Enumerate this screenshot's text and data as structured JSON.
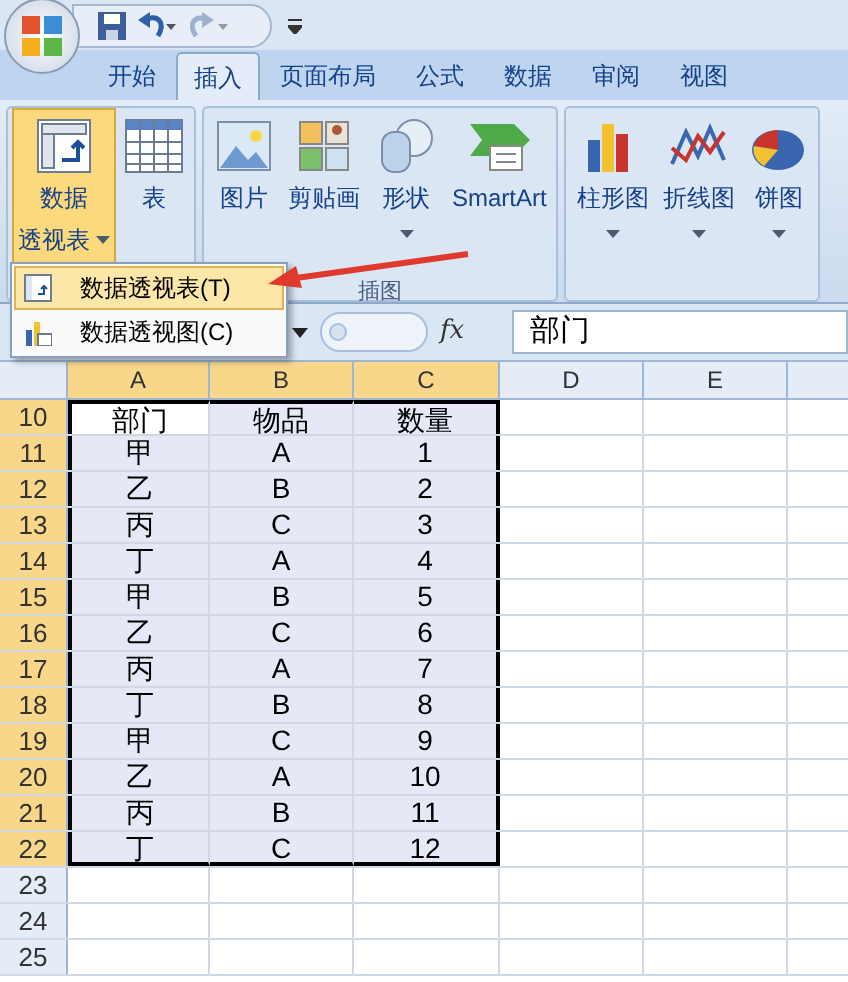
{
  "tabs": [
    {
      "label": "开始",
      "selected": false
    },
    {
      "label": "插入",
      "selected": true
    },
    {
      "label": "页面布局",
      "selected": false
    },
    {
      "label": "公式",
      "selected": false
    },
    {
      "label": "数据",
      "selected": false
    },
    {
      "label": "审阅",
      "selected": false
    },
    {
      "label": "视图",
      "selected": false
    }
  ],
  "ribbon": {
    "groups": [
      {
        "buttons": [
          {
            "kind": "pivot",
            "lines": [
              "数据",
              "透视表"
            ],
            "dropdown": true,
            "selected": true
          },
          {
            "kind": "table",
            "lines": [
              "表"
            ],
            "dropdown": false,
            "selected": false
          }
        ]
      },
      {
        "label": "插图",
        "buttons": [
          {
            "kind": "picture",
            "lines": [
              "图片"
            ],
            "dropdown": false,
            "selected": false
          },
          {
            "kind": "clipart",
            "lines": [
              "剪贴画"
            ],
            "dropdown": false,
            "selected": false
          },
          {
            "kind": "shapes",
            "lines": [
              "形状"
            ],
            "dropdown": true,
            "selected": false
          },
          {
            "kind": "smartart",
            "lines": [
              "SmartArt"
            ],
            "dropdown": false,
            "selected": false
          }
        ]
      },
      {
        "buttons": [
          {
            "kind": "column",
            "lines": [
              "柱形图"
            ],
            "dropdown": true,
            "selected": false
          },
          {
            "kind": "line",
            "lines": [
              "折线图"
            ],
            "dropdown": true,
            "selected": false
          },
          {
            "kind": "pie",
            "lines": [
              "饼图"
            ],
            "dropdown": true,
            "selected": false
          }
        ]
      }
    ]
  },
  "menu": {
    "items": [
      {
        "kind": "pivot",
        "label": "数据透视表(T)",
        "selected": true
      },
      {
        "kind": "chart",
        "label": "数据透视图(C)",
        "selected": false
      }
    ]
  },
  "formula_bar": {
    "function_label": "fx",
    "content": "部门"
  },
  "columns": [
    {
      "label": "A",
      "selected": true
    },
    {
      "label": "B",
      "selected": true
    },
    {
      "label": "C",
      "selected": true
    },
    {
      "label": "D",
      "selected": false
    },
    {
      "label": "E",
      "selected": false
    }
  ],
  "rows": [
    {
      "number": "10",
      "selected": true,
      "cells": [
        "部门",
        "物品",
        "数量"
      ]
    },
    {
      "number": "11",
      "selected": true,
      "cells": [
        "甲",
        "A",
        "1"
      ]
    },
    {
      "number": "12",
      "selected": true,
      "cells": [
        "乙",
        "B",
        "2"
      ]
    },
    {
      "number": "13",
      "selected": true,
      "cells": [
        "丙",
        "C",
        "3"
      ]
    },
    {
      "number": "14",
      "selected": true,
      "cells": [
        "丁",
        "A",
        "4"
      ]
    },
    {
      "number": "15",
      "selected": true,
      "cells": [
        "甲",
        "B",
        "5"
      ]
    },
    {
      "number": "16",
      "selected": true,
      "cells": [
        "乙",
        "C",
        "6"
      ]
    },
    {
      "number": "17",
      "selected": true,
      "cells": [
        "丙",
        "A",
        "7"
      ]
    },
    {
      "number": "18",
      "selected": true,
      "cells": [
        "丁",
        "B",
        "8"
      ]
    },
    {
      "number": "19",
      "selected": true,
      "cells": [
        "甲",
        "C",
        "9"
      ]
    },
    {
      "number": "20",
      "selected": true,
      "cells": [
        "乙",
        "A",
        "10"
      ]
    },
    {
      "number": "21",
      "selected": true,
      "cells": [
        "丙",
        "B",
        "11"
      ]
    },
    {
      "number": "22",
      "selected": true,
      "cells": [
        "丁",
        "C",
        "12"
      ]
    },
    {
      "number": "23",
      "selected": false,
      "cells": []
    },
    {
      "number": "24",
      "selected": false,
      "cells": []
    },
    {
      "number": "25",
      "selected": false,
      "cells": []
    }
  ]
}
